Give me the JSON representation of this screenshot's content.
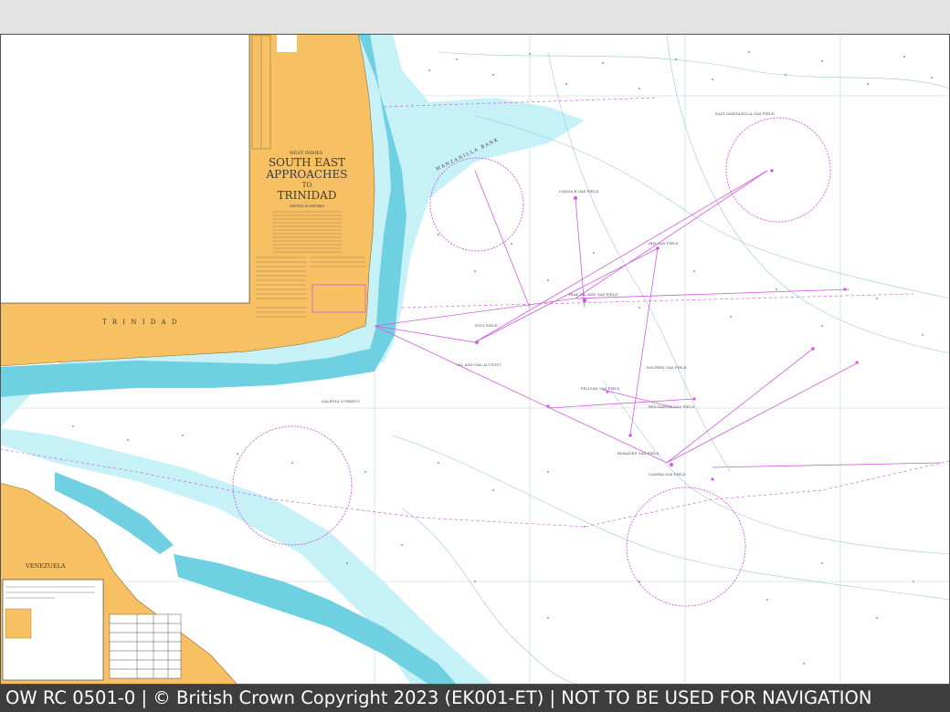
{
  "chart_title": {
    "region": "WEST INDIES",
    "line1": "SOUTH EAST",
    "line2": "APPROACHES",
    "line3": "TO",
    "line4": "TRINIDAD",
    "depths": "DEPTHS IN METRES"
  },
  "place_names": {
    "trinidad": "T R I N I D A D",
    "venezuela": "VENEZUELA",
    "manzanilla_bank": "MANZANILLA BANK"
  },
  "gas_fields": {
    "east_manzanilla": "EAST MANZANILLA GAS FIELD",
    "cassia_b": "CASSIA B GAS FIELD",
    "teak": "TEAK OIL AND GAS FIELD",
    "poui": "POUI FIELD",
    "pelican": "PELICAN GAS FIELD",
    "kiskadee": "KISKADEE GAS FIELD",
    "cassra": "CASSRA GAS FIELD",
    "red_mango": "RED MANGO GAS FIELD",
    "oil_gas_activity": "OIL AND GAS ACTIVITY",
    "galeota_current": "GALEOTA CURRENT",
    "ibis": "IBIS GAS FIELD",
    "dolphin": "DOLPHIN GAS FIELD"
  },
  "footer": {
    "text": "OW RC 0501-0 | © British Crown Copyright 2023 (EK001-ET) | NOT TO BE USED FOR NAVIGATION"
  },
  "colors": {
    "land": "#f6c063",
    "shallow": "#6fd0e2",
    "mid_water": "#c6f1f7",
    "deep_water": "#ffffff",
    "magenta": "#d15be0",
    "footer_bg": "#3d3d3d"
  }
}
